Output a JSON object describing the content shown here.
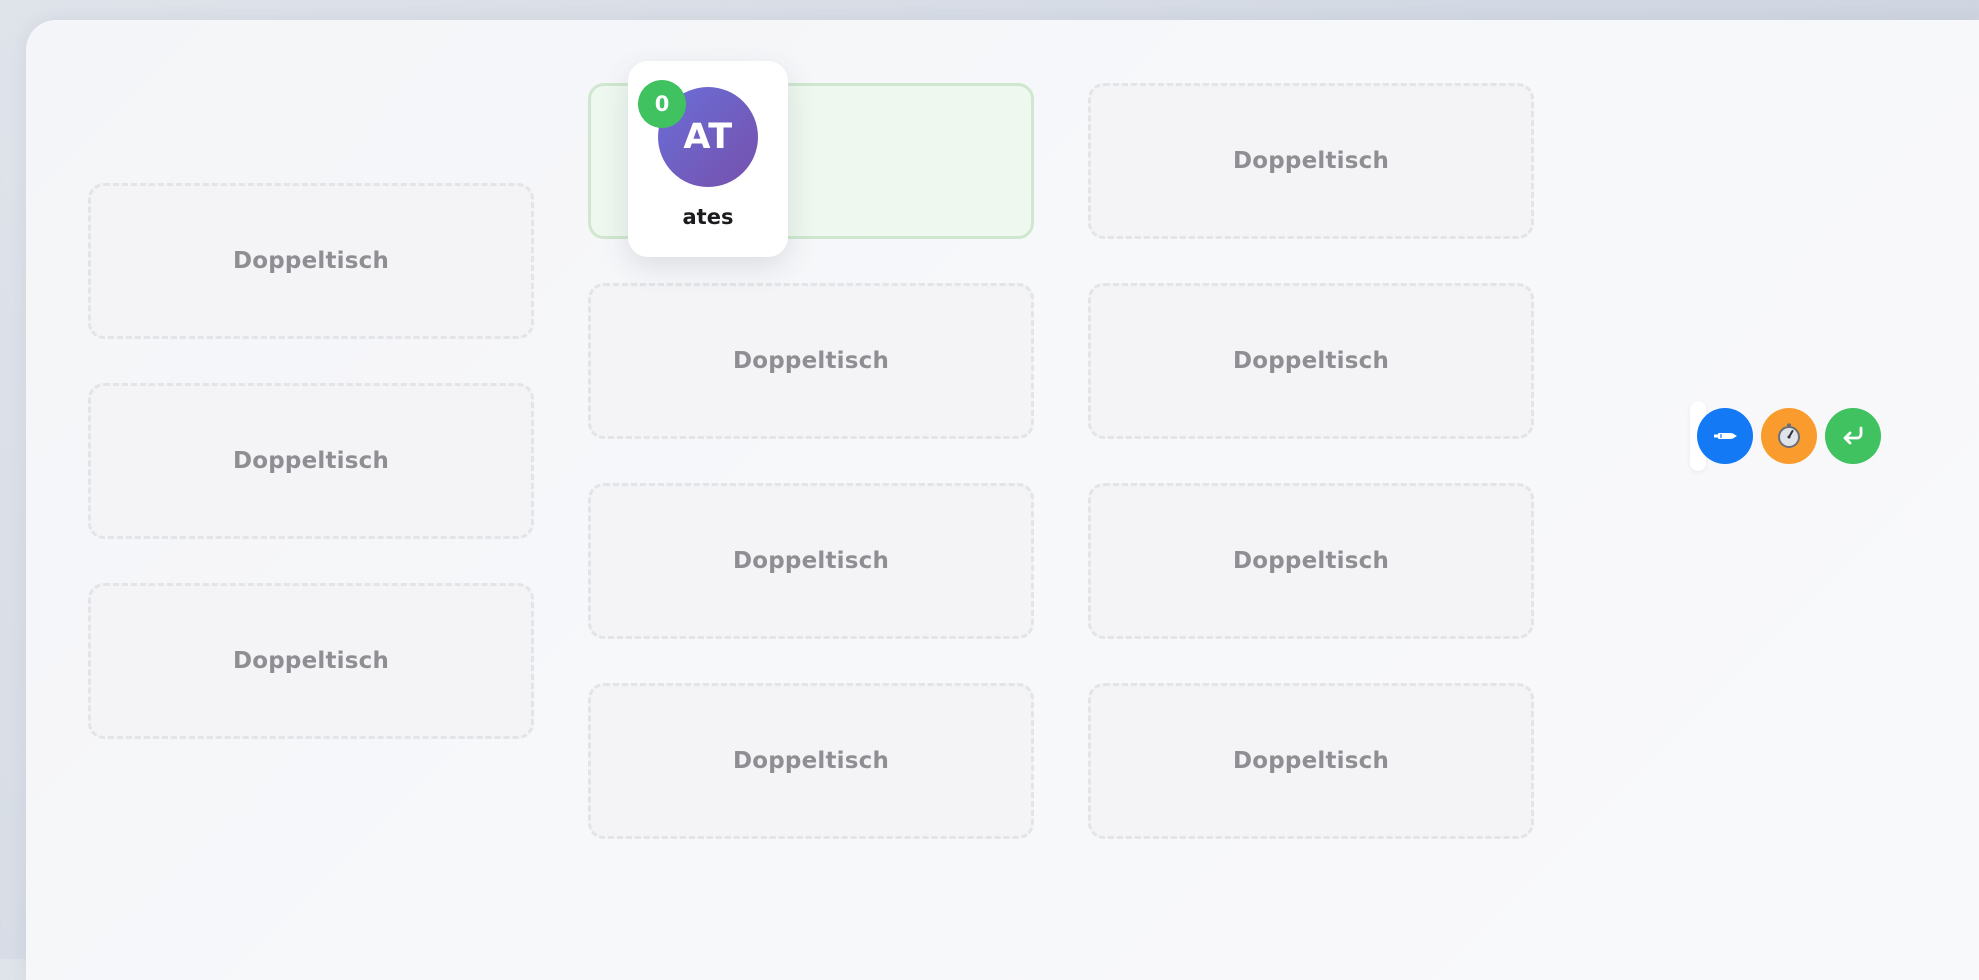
{
  "seats": {
    "label": "Doppeltisch"
  },
  "student": {
    "initials": "AT",
    "name": "ates",
    "points": "0"
  },
  "actions": [
    {
      "name": "pen-button",
      "icon": "pen-icon",
      "color": "#1479f5"
    },
    {
      "name": "timer-button",
      "icon": "stopwatch-icon",
      "color": "#f99c2d"
    },
    {
      "name": "return-button",
      "icon": "return-arrow-icon",
      "color": "#3fc25f"
    }
  ],
  "colors": {
    "avatar_from": "#6a6fd8",
    "avatar_to": "#7650ac",
    "badge": "#3fc25f",
    "occupied_border": "#cfe7cf",
    "occupied_fill": "#eef8ef"
  }
}
